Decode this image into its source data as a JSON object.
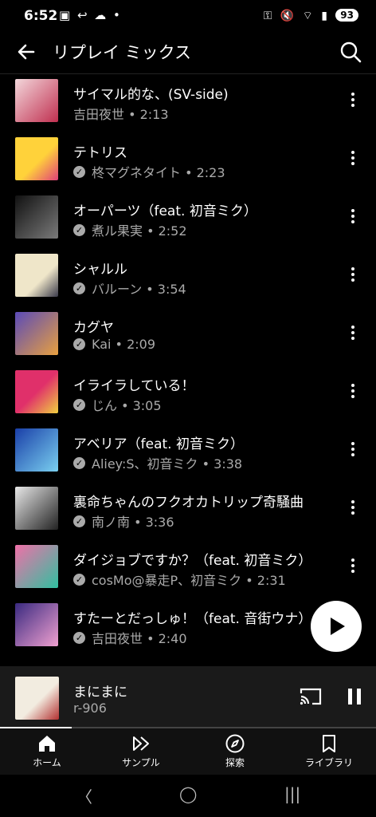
{
  "status_bar": {
    "time": "6:52",
    "left_icons": "▣ ↩ ☁ •",
    "right_icons": "⚿ 🔇 ⌔ ▮",
    "battery": "93"
  },
  "header": {
    "title": "リプレイ ミックス"
  },
  "songs": [
    {
      "title": "サイマル的な、(SV-side)",
      "artist": "吉田夜世 • 2:13",
      "verified": false,
      "thumb": [
        "#f3d7db",
        "#c03050"
      ]
    },
    {
      "title": "テトリス",
      "artist": "柊マグネタイト • 2:23",
      "verified": true,
      "thumb": [
        "#ffd23a",
        "#e0407a"
      ]
    },
    {
      "title": "オーパーツ（feat. 初音ミク）",
      "artist": "煮ル果実 • 2:52",
      "verified": true,
      "thumb": [
        "#111111",
        "#7a7a7a"
      ]
    },
    {
      "title": "シャルル",
      "artist": "バルーン • 3:54",
      "verified": true,
      "thumb": [
        "#efe6c9",
        "#3a3a4a"
      ]
    },
    {
      "title": "カグヤ",
      "artist": "Kai • 2:09",
      "verified": true,
      "thumb": [
        "#5a4ab8",
        "#e8a040"
      ]
    },
    {
      "title": "イライラしている！",
      "artist": "じん • 3:05",
      "verified": true,
      "thumb": [
        "#e0306a",
        "#f0d040"
      ]
    },
    {
      "title": "アベリア（feat. 初音ミク）",
      "artist": "Aliey:S、初音ミク • 3:38",
      "verified": true,
      "thumb": [
        "#1a3fa8",
        "#7ad0f0"
      ]
    },
    {
      "title": "裏命ちゃんのフクオカトリップ奇騒曲",
      "artist": "南ノ南 • 3:36",
      "verified": true,
      "thumb": [
        "#e8e8e8",
        "#222222"
      ]
    },
    {
      "title": "ダイジョブですか？（feat. 初音ミク）",
      "artist": "cosMo@暴走P、初音ミク • 2:31",
      "verified": true,
      "thumb": [
        "#f070a8",
        "#30c0a0"
      ]
    },
    {
      "title": "すたーとだっしゅ！（feat. 音街ウナ）",
      "artist": "吉田夜世 • 2:40",
      "verified": true,
      "thumb": [
        "#3a2a80",
        "#f0a0d0"
      ]
    }
  ],
  "now_playing": {
    "title": "まにまに",
    "artist": "r-906",
    "progress": 0.19,
    "thumb": [
      "#f2ece0",
      "#b23030"
    ]
  },
  "bottom_nav": [
    {
      "label": "ホーム",
      "icon": "home-icon"
    },
    {
      "label": "サンプル",
      "icon": "samples-icon"
    },
    {
      "label": "探索",
      "icon": "explore-icon"
    },
    {
      "label": "ライブラリ",
      "icon": "library-icon"
    }
  ],
  "system_nav": {
    "back": "〈",
    "home": "◯",
    "recents": "|||"
  }
}
